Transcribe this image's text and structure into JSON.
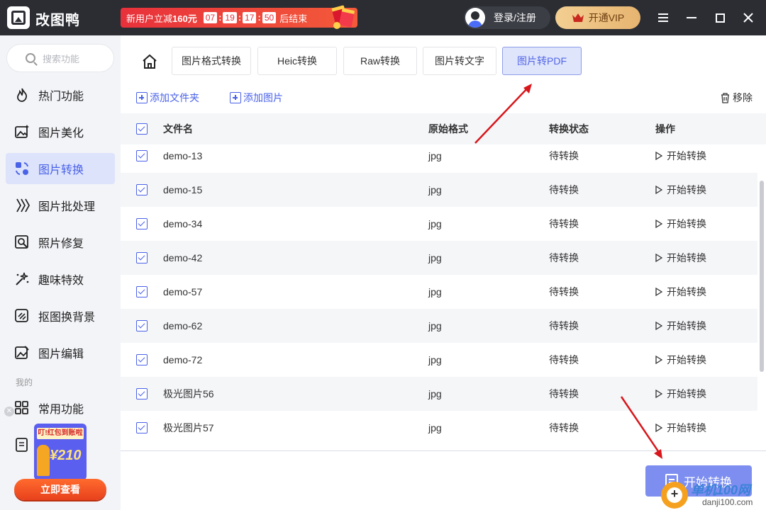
{
  "app": {
    "name": "改图鸭"
  },
  "promo": {
    "prefix": "新用户立减",
    "amount": "160元",
    "countdown": [
      "07",
      "19",
      "17",
      "50"
    ],
    "suffix": "后结束"
  },
  "header": {
    "login_label": "登录/注册",
    "vip_label": "开通VIP"
  },
  "sidebar": {
    "search_placeholder": "搜索功能",
    "items": [
      {
        "label": "热门功能",
        "icon": "fire-icon"
      },
      {
        "label": "图片美化",
        "icon": "image-enhance-icon"
      },
      {
        "label": "图片转换",
        "icon": "convert-icon"
      },
      {
        "label": "图片批处理",
        "icon": "batch-icon"
      },
      {
        "label": "照片修复",
        "icon": "photo-repair-icon"
      },
      {
        "label": "趣味特效",
        "icon": "sparkle-icon"
      },
      {
        "label": "抠图换背景",
        "icon": "cutout-icon"
      },
      {
        "label": "图片编辑",
        "icon": "image-edit-icon"
      }
    ],
    "section_label": "我的",
    "mine_items": [
      {
        "label": "常用功能",
        "icon": "grid-icon"
      }
    ],
    "ad": {
      "title": "叮!红包到账啦",
      "amount": "¥210",
      "button": "立即查看"
    }
  },
  "tabs": [
    "图片格式转换",
    "Heic转换",
    "Raw转换",
    "图片转文字",
    "图片转PDF"
  ],
  "toolbar": {
    "add_folder": "添加文件夹",
    "add_image": "添加图片",
    "remove": "移除"
  },
  "table": {
    "headers": {
      "name": "文件名",
      "format": "原始格式",
      "status": "转换状态",
      "action": "操作"
    },
    "rows": [
      {
        "name": "demo-13",
        "format": "jpg",
        "status": "待转换",
        "action": "开始转换"
      },
      {
        "name": "demo-15",
        "format": "jpg",
        "status": "待转换",
        "action": "开始转换"
      },
      {
        "name": "demo-34",
        "format": "jpg",
        "status": "待转换",
        "action": "开始转换"
      },
      {
        "name": "demo-42",
        "format": "jpg",
        "status": "待转换",
        "action": "开始转换"
      },
      {
        "name": "demo-57",
        "format": "jpg",
        "status": "待转换",
        "action": "开始转换"
      },
      {
        "name": "demo-62",
        "format": "jpg",
        "status": "待转换",
        "action": "开始转换"
      },
      {
        "name": "demo-72",
        "format": "jpg",
        "status": "待转换",
        "action": "开始转换"
      },
      {
        "name": "极光图片56",
        "format": "jpg",
        "status": "待转换",
        "action": "开始转换"
      },
      {
        "name": "极光图片57",
        "format": "jpg",
        "status": "待转换",
        "action": "开始转换"
      }
    ]
  },
  "start_button": "开始转换",
  "watermark": {
    "brand": "单机100网",
    "url": "danji100.com"
  },
  "colors": {
    "accent": "#4a62e8",
    "titlebar": "#2b2d33",
    "promo": "#e8313b",
    "vip": "#e6b470",
    "arrow": "#d8161b"
  }
}
